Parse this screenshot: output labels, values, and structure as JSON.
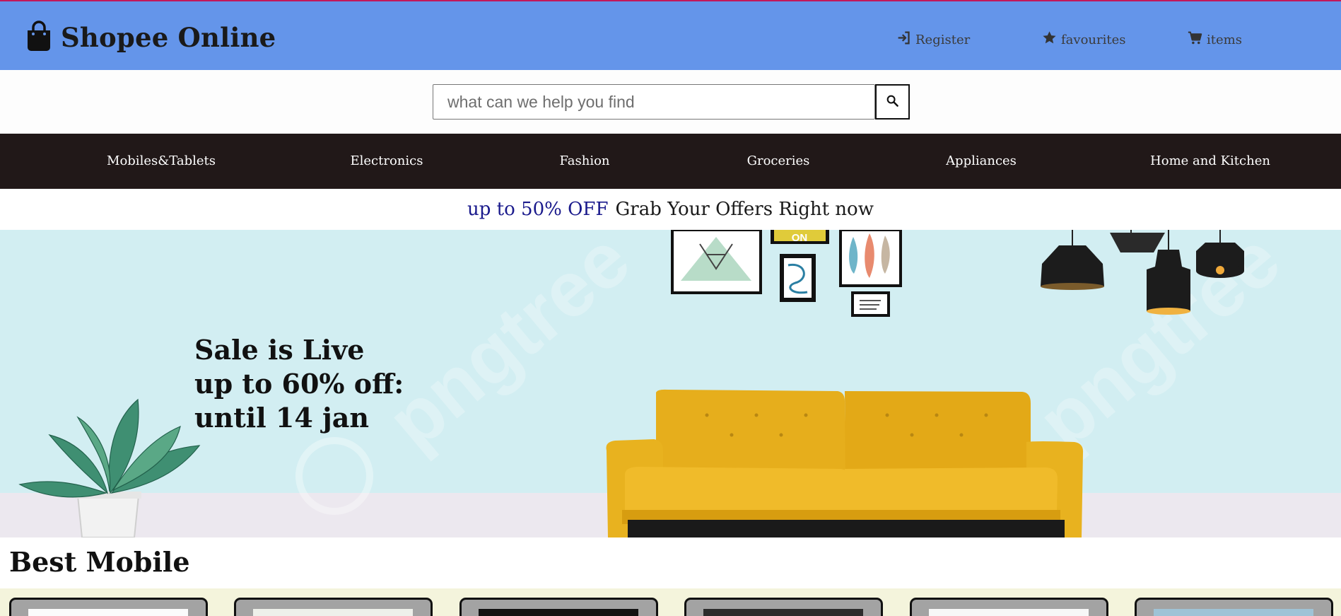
{
  "app": {
    "brand": "Shopee Online",
    "brand_icon": "shopping-bag-icon"
  },
  "header": {
    "links": [
      {
        "label": "Register",
        "icon": "sign-in-icon"
      },
      {
        "label": "favourites",
        "icon": "star-icon"
      },
      {
        "label": "items",
        "icon": "cart-icon"
      }
    ]
  },
  "search": {
    "placeholder": "what can we help you find",
    "value": "",
    "button_icon": "search-icon"
  },
  "categories": [
    "Mobiles&Tablets",
    "Electronics",
    "Fashion",
    "Groceries",
    "Appliances",
    "Home and Kitchen"
  ],
  "offer": {
    "highlight": "up to 50% OFF",
    "text": "Grab Your Offers Right now"
  },
  "banner": {
    "lines": [
      "Sale is Live",
      "up to 60% off:",
      "until 14 jan"
    ],
    "wall_sign": "ON"
  },
  "best_mobile": {
    "title": "Best Mobile",
    "products": 6
  },
  "colors": {
    "header_bg": "#6495ea",
    "nav_bg": "#211818",
    "banner_bg": "#d2eef2",
    "sofa": "#e9b31e",
    "offer_highlight": "#1a1a8c",
    "product_strip_bg": "#f4f4dc"
  }
}
